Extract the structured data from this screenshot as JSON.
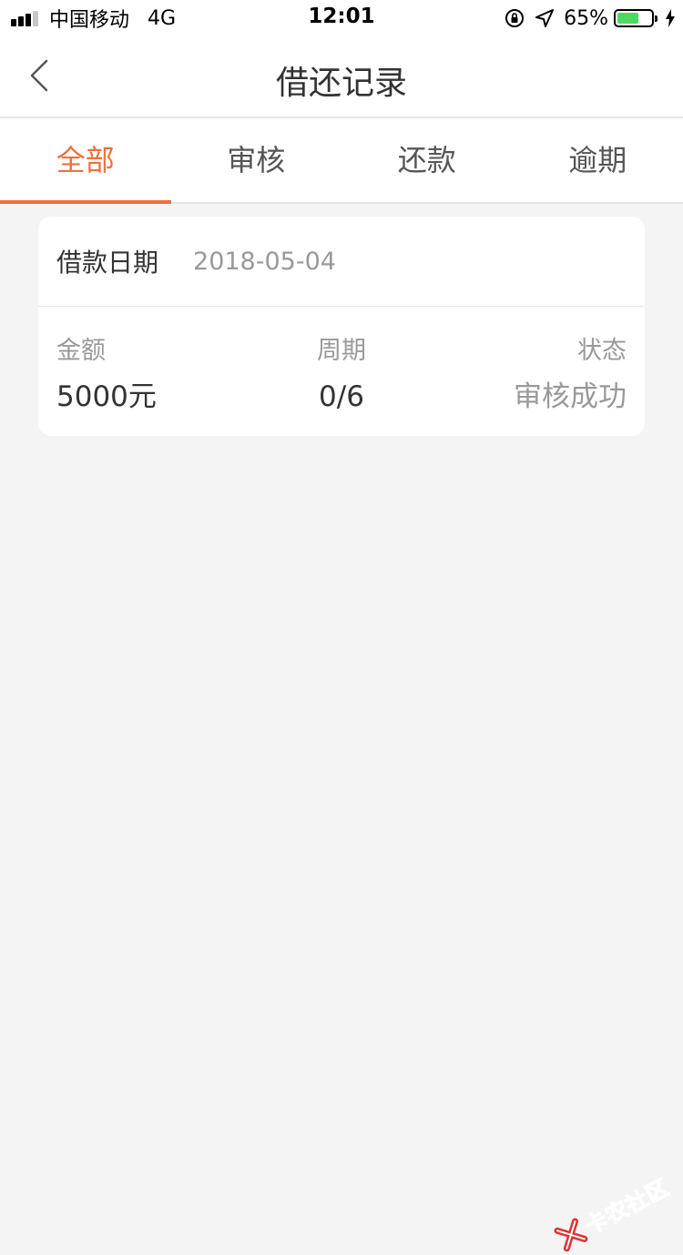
{
  "status_bar": {
    "carrier": "中国移动",
    "network": "4G",
    "time": "12:01",
    "battery_percent": "65%",
    "battery_level": 0.65,
    "battery_color": "#4cd964"
  },
  "nav": {
    "back_icon": "chevron-left-icon",
    "title": "借还记录"
  },
  "tabs": [
    {
      "label": "全部",
      "active": true
    },
    {
      "label": "审核",
      "active": false
    },
    {
      "label": "还款",
      "active": false
    },
    {
      "label": "逾期",
      "active": false
    }
  ],
  "record": {
    "date_label": "借款日期",
    "date_value": "2018-05-04",
    "amount_label": "金额",
    "amount_value": "5000元",
    "period_label": "周期",
    "period_value": "0/6",
    "status_label": "状态",
    "status_value": "审核成功"
  },
  "watermark": {
    "text": "卡农社区"
  },
  "colors": {
    "accent": "#f0703a",
    "background": "#f4f4f4",
    "muted_text": "#999999"
  }
}
